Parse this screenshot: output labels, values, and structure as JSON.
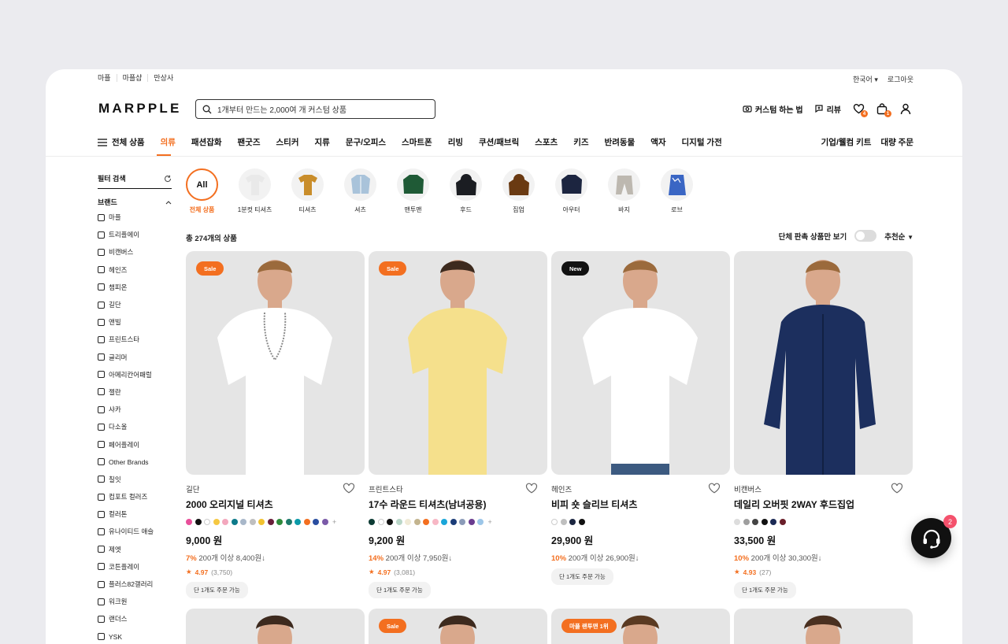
{
  "util": {
    "left": [
      "마플",
      "마플샵",
      "만상사"
    ],
    "lang": "한국어",
    "logout": "로그아웃"
  },
  "logo": "MARPPLE",
  "search": {
    "placeholder": "1개부터 만드는 2,000여 개 커스텀 상품"
  },
  "header": {
    "howto": "커스텀 하는 법",
    "review": "리뷰",
    "wish_count": "4",
    "cart_count": "1"
  },
  "nav": {
    "all": "전체 상품",
    "items": [
      "의류",
      "패션잡화",
      "팬굿즈",
      "스티커",
      "지류",
      "문구/오피스",
      "스마트폰",
      "리빙",
      "쿠션/패브릭",
      "스포츠",
      "키즈",
      "반려동물",
      "액자",
      "디지털 가전"
    ],
    "right": [
      "기업/웰컴 키트",
      "대량 주문"
    ]
  },
  "filter": {
    "title": "필터 검색",
    "brand_title": "브랜드",
    "brands": [
      "마플",
      "트리플에이",
      "비캔버스",
      "헤인즈",
      "챔피온",
      "길단",
      "앤빌",
      "프린트스타",
      "글리머",
      "아메리칸어패럴",
      "젤란",
      "샤카",
      "다소올",
      "페어플레이",
      "Other Brands",
      "칠잇",
      "컴포트 컬러즈",
      "컬러톤",
      "유나이티드 애슬",
      "제엣",
      "코튼플레이",
      "플러스82갤러리",
      "워크원",
      "랜더스",
      "YSK"
    ]
  },
  "chips": [
    {
      "label": "전체 상품",
      "text": "All"
    },
    {
      "label": "1분컷 티셔츠"
    },
    {
      "label": "티셔츠"
    },
    {
      "label": "셔츠"
    },
    {
      "label": "맨투맨"
    },
    {
      "label": "후드"
    },
    {
      "label": "집업"
    },
    {
      "label": "아우터"
    },
    {
      "label": "바지"
    },
    {
      "label": "로브"
    }
  ],
  "count": {
    "total": "총 274개의 상품",
    "toggle_label": "단체 판촉 상품만 보기",
    "sort": "추천순"
  },
  "products": [
    {
      "tag": "Sale",
      "brand": "길단",
      "name": "2000 오리지널 티셔츠",
      "price": "9,000 원",
      "disc_pct": "7%",
      "disc_text": "200개 이상 8,400원↓",
      "score": "4.97",
      "reviews": "(3,750)",
      "min": "단 1개도 주문 가능",
      "colors": [
        "#e84f9a",
        "#111111",
        "#ffffff",
        "#f5c842",
        "#f3a7bd",
        "#0d7a8a",
        "#a8b7c9",
        "#bfbfbf",
        "#f2c230",
        "#6a1f3a",
        "#2f8a3a",
        "#1e7a6b",
        "#0b9aa8",
        "#f36f20",
        "#2a4ea0",
        "#7b5aa8"
      ]
    },
    {
      "tag": "Sale",
      "brand": "프린트스타",
      "name": "17수 라운드 티셔츠(남녀공용)",
      "price": "9,200 원",
      "disc_pct": "14%",
      "disc_text": "200개 이상 7,950원↓",
      "score": "4.97",
      "reviews": "(3,081)",
      "min": "단 1개도 주문 가능",
      "colors": [
        "#0d3b34",
        "#ffffff",
        "#111111",
        "#b9d6c8",
        "#f0ead6",
        "#c3b48f",
        "#f36f20",
        "#f7b7c5",
        "#1aa6d9",
        "#1b3c78",
        "#8b9bb8",
        "#6a3c8f",
        "#9cc6e8"
      ]
    },
    {
      "tag": "New",
      "brand": "헤인즈",
      "name": "비피 숏 슬리브 티셔츠",
      "price": "29,900 원",
      "disc_pct": "10%",
      "disc_text": "200개 이상 26,900원↓",
      "score": "",
      "reviews": "",
      "min": "단 1개도 주문 가능",
      "colors": [
        "#ffffff",
        "#bfbfbf",
        "#1c2640",
        "#111111"
      ]
    },
    {
      "tag": "",
      "brand": "비캔버스",
      "name": "데일리 오버핏 2WAY 후드집업",
      "price": "33,500 원",
      "disc_pct": "10%",
      "disc_text": "200개 이상 30,300원↓",
      "score": "4.93",
      "reviews": "(27)",
      "min": "단 1개도 주문 가능",
      "colors": [
        "#dddddd",
        "#9e9e9e",
        "#444444",
        "#111111",
        "#1c2a55",
        "#6a1f2a"
      ]
    }
  ],
  "row2_tags": [
    "",
    "Sale",
    "마플 랜투맨 1위",
    ""
  ],
  "help_badge": "2",
  "colors": {
    "accent": "#f36f20"
  }
}
